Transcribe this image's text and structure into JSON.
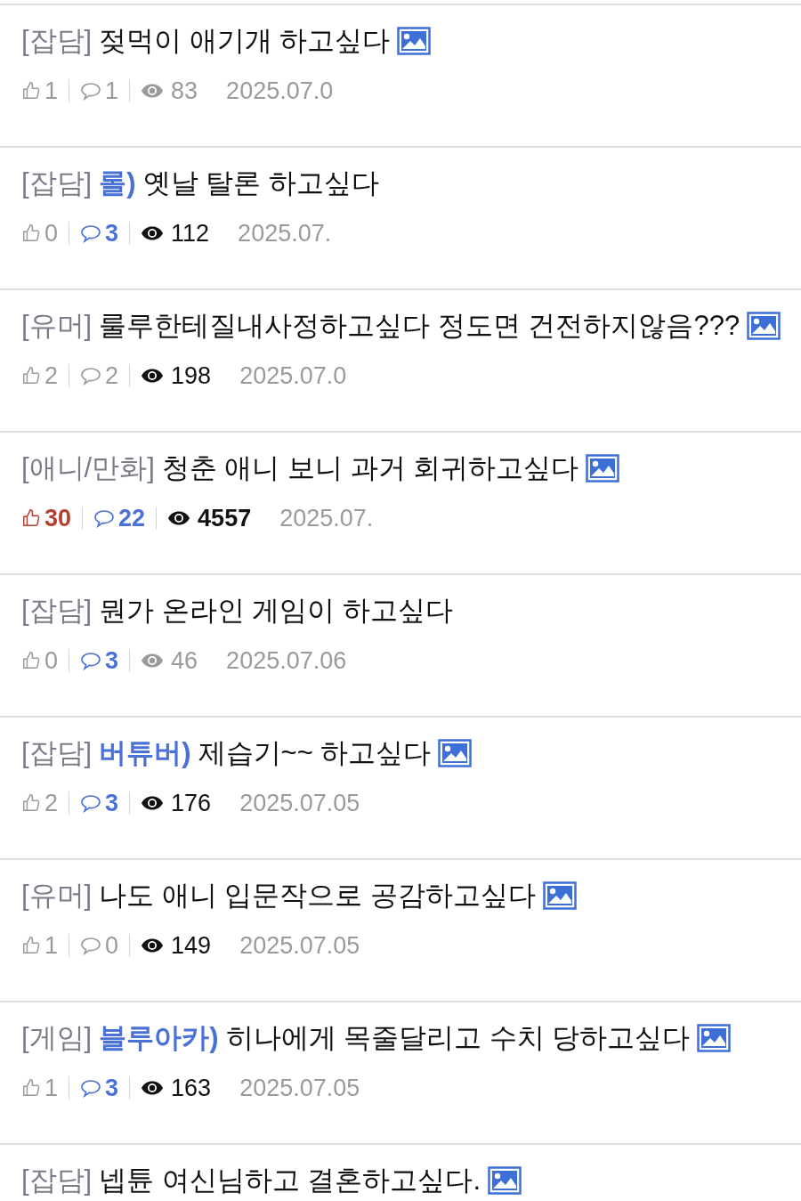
{
  "posts": [
    {
      "category": "[잡담]",
      "title": "젖먹이 애기개 하고싶다",
      "has_image": true,
      "likes": {
        "count": "1",
        "highlighted": false
      },
      "comments": {
        "count": "1",
        "highlighted": false
      },
      "views": {
        "count": "83",
        "highlighted": false,
        "bold": false
      },
      "date": "2025.07.0"
    },
    {
      "category": "[잡담]",
      "prefix": "롤)",
      "title": "옛날 탈론 하고싶다",
      "has_image": false,
      "likes": {
        "count": "0",
        "highlighted": false
      },
      "comments": {
        "count": "3",
        "highlighted": true
      },
      "views": {
        "count": "112",
        "highlighted": true,
        "bold": false
      },
      "date": "2025.07."
    },
    {
      "category": "[유머]",
      "title": "룰루한테질내사정하고싶다 정도면 건전하지않음???",
      "has_image": true,
      "likes": {
        "count": "2",
        "highlighted": false
      },
      "comments": {
        "count": "2",
        "highlighted": false
      },
      "views": {
        "count": "198",
        "highlighted": true,
        "bold": false
      },
      "date": "2025.07.0"
    },
    {
      "category": "[애니/만화]",
      "title": "청춘 애니 보니 과거 회귀하고싶다",
      "has_image": true,
      "likes": {
        "count": "30",
        "highlighted": true
      },
      "comments": {
        "count": "22",
        "highlighted": true
      },
      "views": {
        "count": "4557",
        "highlighted": true,
        "bold": true
      },
      "date": "2025.07."
    },
    {
      "category": "[잡담]",
      "title": "뭔가 온라인 게임이 하고싶다",
      "has_image": false,
      "likes": {
        "count": "0",
        "highlighted": false
      },
      "comments": {
        "count": "3",
        "highlighted": true
      },
      "views": {
        "count": "46",
        "highlighted": false,
        "bold": false
      },
      "date": "2025.07.06"
    },
    {
      "category": "[잡담]",
      "prefix": "버튜버)",
      "title": "제습기~~ 하고싶다",
      "has_image": true,
      "likes": {
        "count": "2",
        "highlighted": false
      },
      "comments": {
        "count": "3",
        "highlighted": true
      },
      "views": {
        "count": "176",
        "highlighted": true,
        "bold": false
      },
      "date": "2025.07.05"
    },
    {
      "category": "[유머]",
      "title": "나도 애니 입문작으로 공감하고싶다",
      "has_image": true,
      "likes": {
        "count": "1",
        "highlighted": false
      },
      "comments": {
        "count": "0",
        "highlighted": false
      },
      "views": {
        "count": "149",
        "highlighted": true,
        "bold": false
      },
      "date": "2025.07.05"
    },
    {
      "category": "[게임]",
      "prefix": "블루아카)",
      "title": "히나에게 목줄달리고 수치 당하고싶다",
      "has_image": true,
      "likes": {
        "count": "1",
        "highlighted": false
      },
      "comments": {
        "count": "3",
        "highlighted": true
      },
      "views": {
        "count": "163",
        "highlighted": true,
        "bold": false
      },
      "date": "2025.07.05"
    },
    {
      "category": "[잡담]",
      "title": "넵튠 여신님하고 결혼하고싶다.",
      "has_image": true
    }
  ]
}
